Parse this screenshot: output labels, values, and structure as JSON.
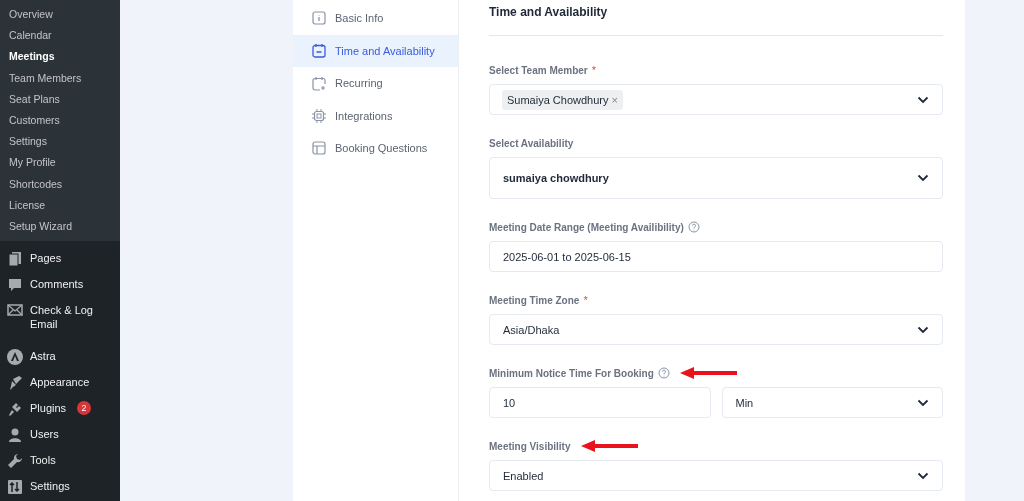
{
  "sidebar": {
    "submenu": [
      {
        "label": "Overview",
        "selected": false
      },
      {
        "label": "Calendar",
        "selected": false
      },
      {
        "label": "Meetings",
        "selected": true
      },
      {
        "label": "Team Members",
        "selected": false
      },
      {
        "label": "Seat Plans",
        "selected": false
      },
      {
        "label": "Customers",
        "selected": false
      },
      {
        "label": "Settings",
        "selected": false
      },
      {
        "label": "My Profile",
        "selected": false
      },
      {
        "label": "Shortcodes",
        "selected": false
      },
      {
        "label": "License",
        "selected": false
      },
      {
        "label": "Setup Wizard",
        "selected": false
      }
    ],
    "menu_groups": [
      [
        {
          "label": "Pages"
        },
        {
          "label": "Comments"
        },
        {
          "label": "Check & Log Email"
        }
      ],
      [
        {
          "label": "Astra"
        },
        {
          "label": "Appearance"
        },
        {
          "label": "Plugins",
          "badge": "2"
        },
        {
          "label": "Users"
        },
        {
          "label": "Tools"
        },
        {
          "label": "Settings"
        }
      ]
    ]
  },
  "tabs": [
    {
      "label": "Basic Info",
      "selected": false
    },
    {
      "label": "Time and Availability",
      "selected": true
    },
    {
      "label": "Recurring",
      "selected": false
    },
    {
      "label": "Integrations",
      "selected": false
    },
    {
      "label": "Booking Questions",
      "selected": false
    }
  ],
  "section": {
    "title": "Time and Availability",
    "fields": [
      {
        "label": "Select Team Member",
        "required_mark": "*",
        "help": false,
        "arrow": false,
        "kind": "tags",
        "tags": [
          {
            "label": "Sumaiya Chowdhury",
            "remove": "×"
          }
        ]
      },
      {
        "label": "Select Availability",
        "help": false,
        "arrow": false,
        "kind": "select",
        "value": "sumaiya chowdhury"
      },
      {
        "label": "Meeting Date Range (Meeting Availibility)",
        "help": true,
        "arrow": false,
        "kind": "input",
        "value": "2025-06-01 to 2025-06-15"
      },
      {
        "label": "Meeting Time Zone",
        "required_mark": "*",
        "help": false,
        "arrow": false,
        "kind": "select",
        "value": "Asia/Dhaka"
      },
      {
        "label": "Minimum Notice Time For Booking",
        "help": true,
        "arrow": true,
        "kind": "split",
        "value": "10",
        "unit": "Min"
      },
      {
        "label": "Meeting Visibility",
        "help": false,
        "arrow": true,
        "kind": "select",
        "value": "Enabled"
      }
    ]
  }
}
